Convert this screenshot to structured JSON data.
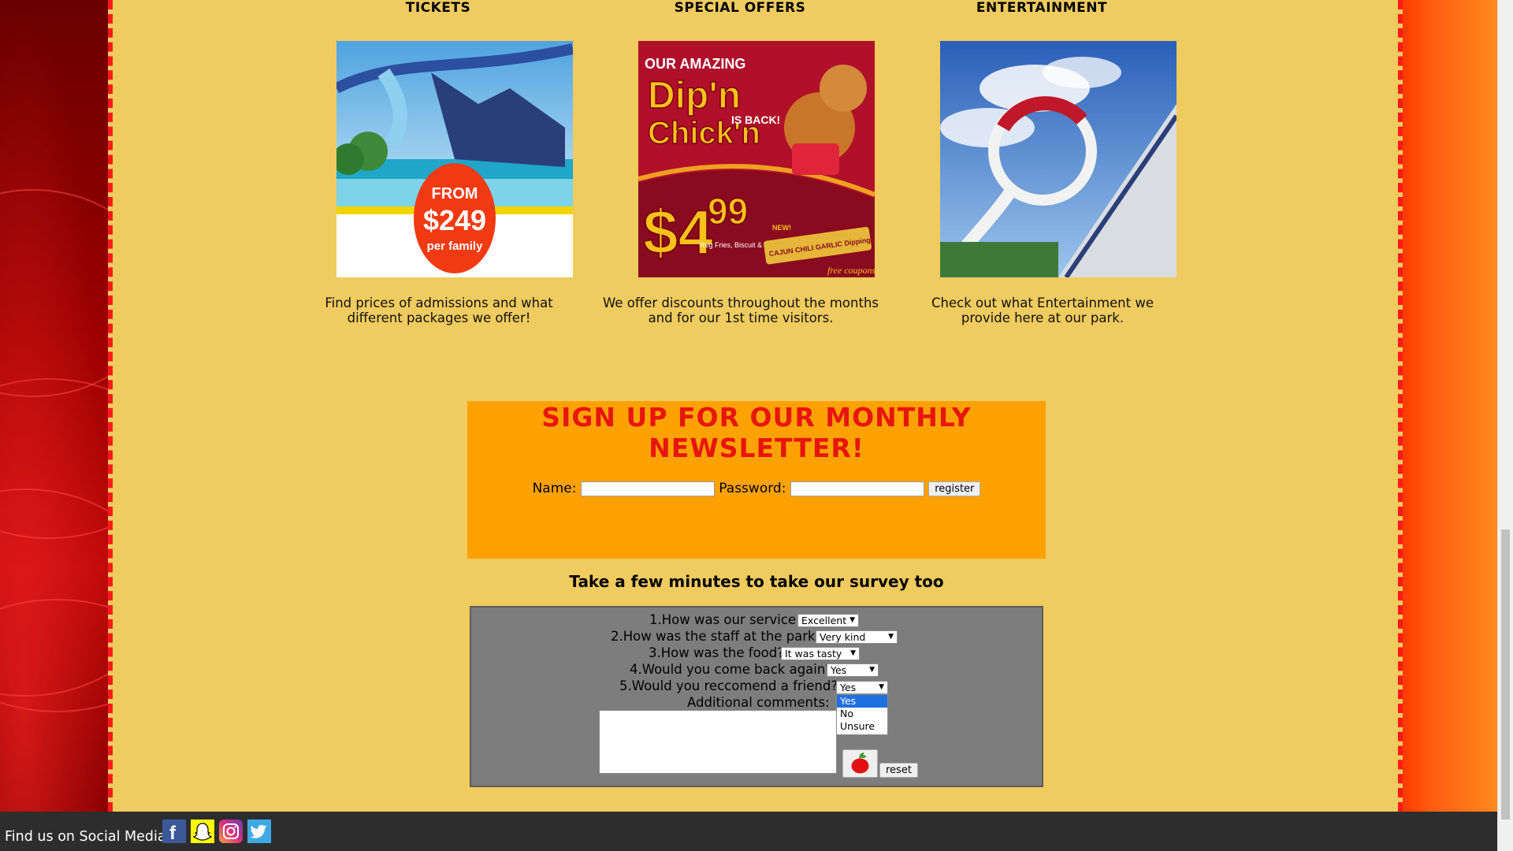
{
  "sections": [
    {
      "title": "TICKETS",
      "description": "Find prices of admissions and what different packages we offer!",
      "promo": {
        "line1": "FROM",
        "price": "$249",
        "line3": "per family"
      }
    },
    {
      "title": "SPECIAL OFFERS",
      "description": "We offer discounts throughout the months and for our 1st time visitors.",
      "promo": {
        "top": "OUR AMAZING",
        "dip": "Dip'n",
        "chick": "Chick'n",
        "back": "IS BACK!",
        "price": "$4",
        "cents": "99",
        "detail": "Reg Fries, Biscuit & EXTRA-LARGE SERVING of",
        "new": "NEW!",
        "sauce": "CAJUN CHILI GARLIC Dipping Sauce",
        "coupons": "free coupons"
      }
    },
    {
      "title": "ENTERTAINMENT",
      "description": "Check out what Entertainment we provide here at our park."
    }
  ],
  "newsletter": {
    "title": "SIGN UP FOR OUR MONTHLY NEWSLETTER!",
    "name_label": "Name:",
    "password_label": "Password:",
    "register_label": "register",
    "name_value": "",
    "password_value": ""
  },
  "survey": {
    "title": "Take a few minutes to take our survey too",
    "questions": [
      {
        "label": "1.How was our service",
        "selected": "Excellent"
      },
      {
        "label": "2.How was the staff at the park",
        "selected": "Very kind"
      },
      {
        "label": "3.How was the food?",
        "selected": "It was tasty"
      },
      {
        "label": "4.Would you come back again?",
        "selected": "Yes"
      },
      {
        "label": "5.Would you reccomend a friend?",
        "selected": "Yes",
        "open_options": [
          "Yes",
          "No",
          "Unsure"
        ]
      }
    ],
    "comments_label": "Additional comments:",
    "comments_value": "",
    "submit_icon": "apple-icon",
    "reset_label": "reset"
  },
  "footer": {
    "label": "Find us on Social Media:",
    "icons": [
      "facebook-icon",
      "snapchat-icon",
      "instagram-icon",
      "twitter-icon"
    ]
  },
  "colors": {
    "page_bg": "#efcb60",
    "newsletter_bg": "#ffa200",
    "newsletter_title": "#e8150f",
    "survey_bg": "#7d7d7d",
    "footer_bg": "#2d2d2d",
    "border_dash": "#ff1a1a"
  }
}
